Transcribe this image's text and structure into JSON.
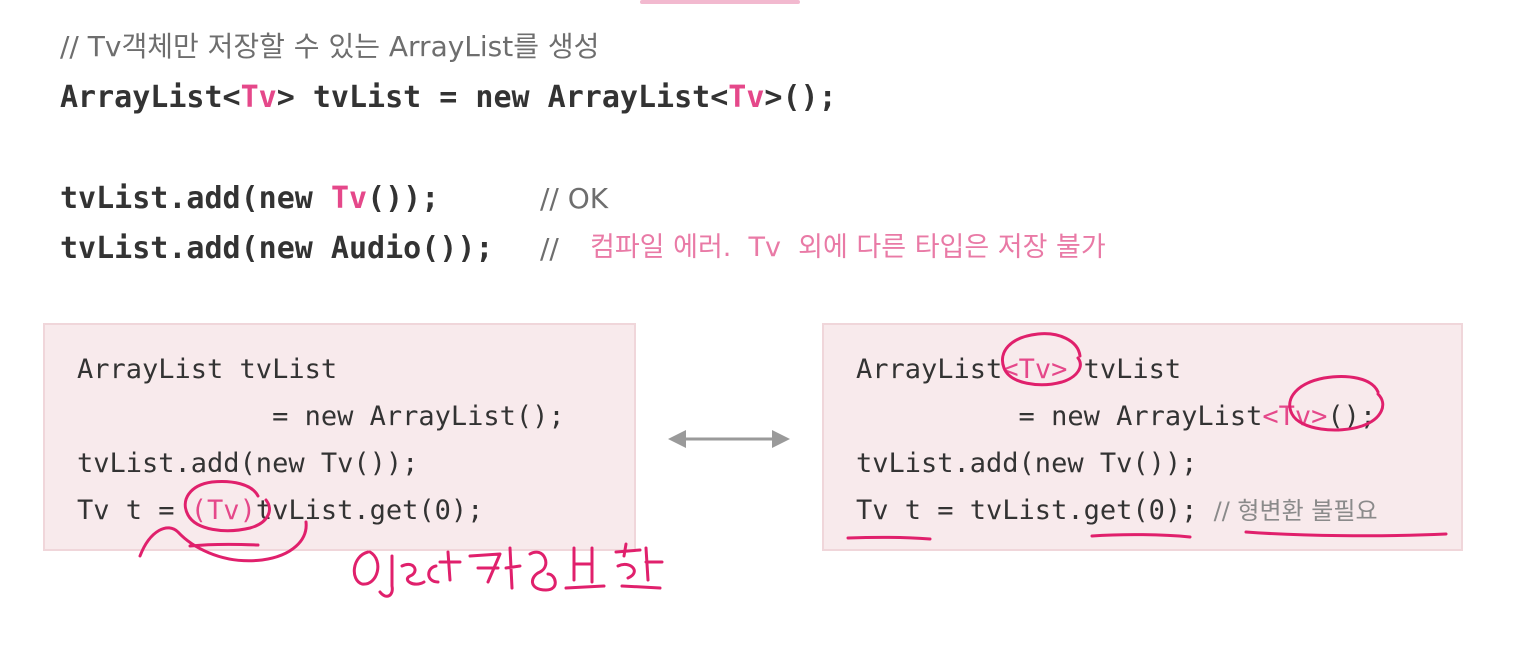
{
  "colors": {
    "accent": "#e5488a",
    "box_bg": "#f8eaec",
    "comment": "#6e6e6e",
    "annotation": "#e0206c"
  },
  "header": {
    "comment": "// Tv객체만 저장할 수 있는 ArrayList를 생성",
    "decl": {
      "p1": "ArrayList<",
      "t1": "Tv",
      "p2": "> tvList = new ArrayList<",
      "t2": "Tv",
      "p3": ">();"
    }
  },
  "add_lines": {
    "ok": {
      "p1": "tvList.add(new ",
      "t1": "Tv",
      "p2": "());",
      "comment": "// OK"
    },
    "error": {
      "code": "tvList.add(new Audio());",
      "slash": "//",
      "comment": "컴파일 에러.  Tv  외에 다른 타입은 저장 불가"
    }
  },
  "left_box": {
    "lines": [
      "ArrayList tvList",
      "            = new ArrayList();",
      "tvList.add(new Tv());"
    ],
    "last": {
      "p1": "Tv t = ",
      "cast": "(Tv)",
      "p2": "tvList.get(0);"
    }
  },
  "right_box": {
    "l1": {
      "p1": "ArrayList",
      "t": "<Tv>",
      "p2": " tvList"
    },
    "l2": {
      "p1": "          = new ArrayList",
      "t": "<Tv>",
      "p2": "();"
    },
    "l3": "tvList.add(new Tv());",
    "l4": {
      "code": "Tv t = tvList.get(0); ",
      "comment": "// 형변환 불필요"
    }
  },
  "arrow": {
    "icon": "double-arrow-icon"
  },
  "handwriting": "Object타입 반환"
}
